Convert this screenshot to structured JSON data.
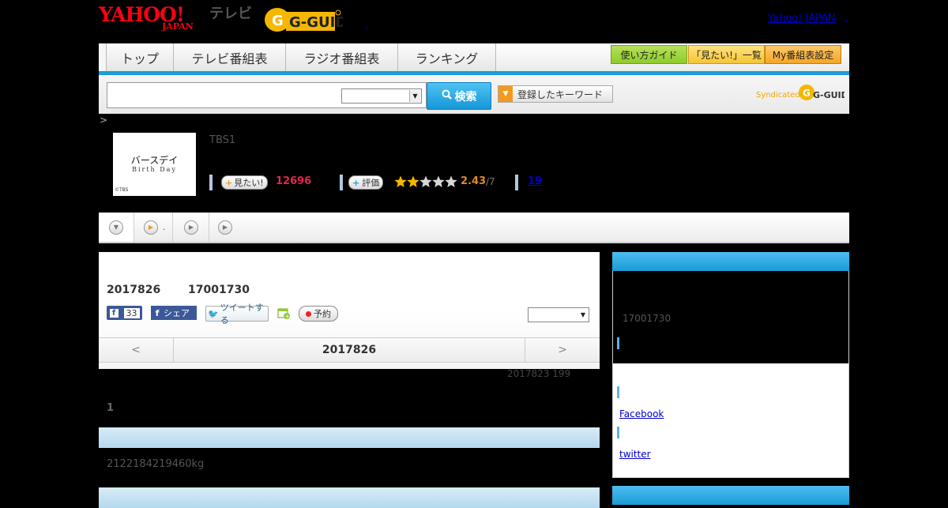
{
  "header": {
    "yahoo_logo": "YAHOO!",
    "yahoo_logo_sub": "JAPAN",
    "tv_label": "テレビ",
    "gguide_logo": "G-GUIDE",
    "yahoo_japan_link": "Yahoo! JAPAN",
    "link_dot": ","
  },
  "nav": {
    "tabs": [
      {
        "label": "トップ"
      },
      {
        "label": "テレビ番組表"
      },
      {
        "label": "ラジオ番組表"
      },
      {
        "label": "ランキング"
      }
    ],
    "buttons": [
      {
        "label": "使い方ガイド",
        "color": "#8fcc2b"
      },
      {
        "label": "「見たい!」一覧",
        "color": "#f6c533"
      },
      {
        "label": "My番組表設定",
        "color": "#f5a623"
      }
    ]
  },
  "search": {
    "placeholder": "",
    "button_label": "検索",
    "keyword_button": "登録したキーワード",
    "syndicated_label": "Syndicated",
    "syndicated_logo": "G-GUIDE"
  },
  "breadcrumb": ">",
  "program": {
    "thumb_title": "バースデイ",
    "thumb_subtitle": "Birth Day",
    "thumb_copyright": "©TBS",
    "channel": "TBS1",
    "want_label": "見たい!",
    "want_count": "12696",
    "rate_label": "評価",
    "rating": "2.43",
    "rating_of": "/7",
    "stars_filled": 2,
    "stars_total": 5,
    "review_count": "19"
  },
  "subtabs": [
    {
      "icon": "down-arrow-icon",
      "label": ""
    },
    {
      "icon": "play-icon",
      "label": "."
    },
    {
      "icon": "play-icon",
      "label": ""
    },
    {
      "icon": "play-icon",
      "label": ""
    }
  ],
  "main": {
    "date": "2017826",
    "time": "17001730",
    "fb_like_count": "33",
    "fb_share_label": "シェア",
    "tweet_label": "ツイートする",
    "reserve_label": "予約",
    "prev": "<",
    "next": ">",
    "nav_date": "2017826",
    "updated": "2017823  199",
    "count": "1",
    "body": "2122184219460kg"
  },
  "side": {
    "time": "17001730",
    "facebook_link": "Facebook",
    "twitter_link": "twitter"
  },
  "colors": {
    "accent_blue": "#1a9ed8",
    "want_pink": "#e2264d",
    "rating_orange": "#e08a22"
  }
}
